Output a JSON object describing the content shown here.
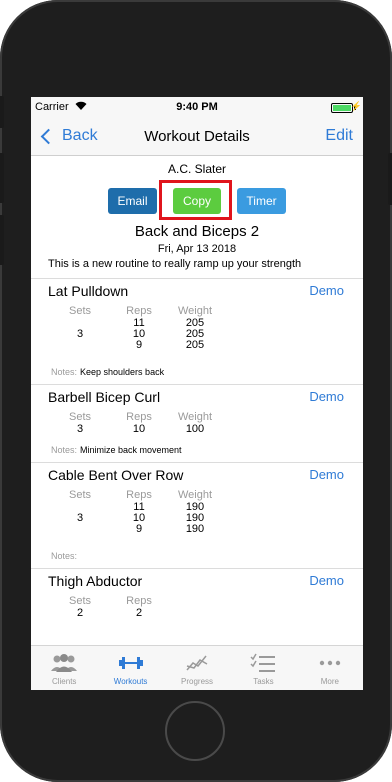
{
  "status_bar": {
    "carrier": "Carrier",
    "time": "9:40 PM"
  },
  "nav": {
    "back_label": "Back",
    "title": "Workout Details",
    "edit_label": "Edit"
  },
  "header": {
    "client_name": "A.C. Slater",
    "email_label": "Email",
    "copy_label": "Copy",
    "timer_label": "Timer",
    "routine_title": "Back and Biceps 2",
    "routine_date": "Fri, Apr 13 2018",
    "routine_description": "This is a new routine to really ramp up your strength"
  },
  "table_headers": {
    "sets": "Sets",
    "reps": "Reps",
    "weight": "Weight",
    "notes": "Notes:"
  },
  "exercises": [
    {
      "name": "Lat Pulldown",
      "demo_label": "Demo",
      "sets": "3",
      "reps": [
        "11",
        "10",
        "9"
      ],
      "weights": [
        "205",
        "205",
        "205"
      ],
      "notes": "Keep shoulders back"
    },
    {
      "name": "Barbell Bicep Curl",
      "demo_label": "Demo",
      "sets": "3",
      "reps": [
        "10"
      ],
      "weights": [
        "100"
      ],
      "notes": "Minimize back movement"
    },
    {
      "name": "Cable Bent Over Row",
      "demo_label": "Demo",
      "sets": "3",
      "reps": [
        "11",
        "10",
        "9"
      ],
      "weights": [
        "190",
        "190",
        "190"
      ],
      "notes": ""
    },
    {
      "name": "Thigh Abductor",
      "demo_label": "Demo",
      "sets": "2",
      "reps": [
        "2"
      ],
      "weights": [],
      "notes": ""
    }
  ],
  "tabs": [
    {
      "label": "Clients",
      "icon": "clients-icon"
    },
    {
      "label": "Workouts",
      "icon": "dumbbell-icon"
    },
    {
      "label": "Progress",
      "icon": "progress-chart-icon"
    },
    {
      "label": "Tasks",
      "icon": "tasks-checklist-icon"
    },
    {
      "label": "More",
      "icon": "more-dots-icon"
    }
  ],
  "colors": {
    "accent": "#2f7bd6",
    "email_button": "#1e6dab",
    "copy_button": "#5ccc3f",
    "timer_button": "#3a9be0",
    "highlight_box": "#e0141c"
  }
}
